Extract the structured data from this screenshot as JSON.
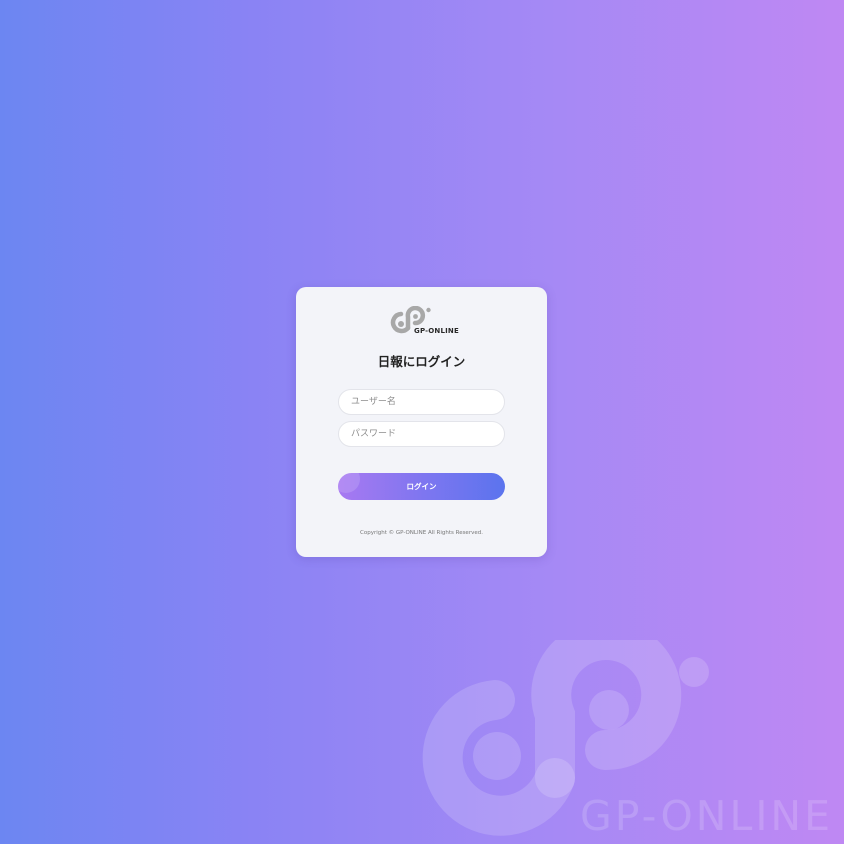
{
  "brand": {
    "name": "GP-ONLINE",
    "logo_icon": "gp-online-logo-icon",
    "watermark_text": "GP-ONLINE"
  },
  "login": {
    "title": "日報にログイン",
    "username_placeholder": "ユーザー名",
    "password_placeholder": "パスワード",
    "button_label": "ログイン"
  },
  "footer": {
    "copyright": "Copyright © GP-ONLINE All Rights Reserved."
  },
  "colors": {
    "background_left": "#6c86f2",
    "background_right": "#bf88f3",
    "card_background": "#f3f4f9",
    "button_start": "#a879f1",
    "button_end": "#5b74ee"
  }
}
